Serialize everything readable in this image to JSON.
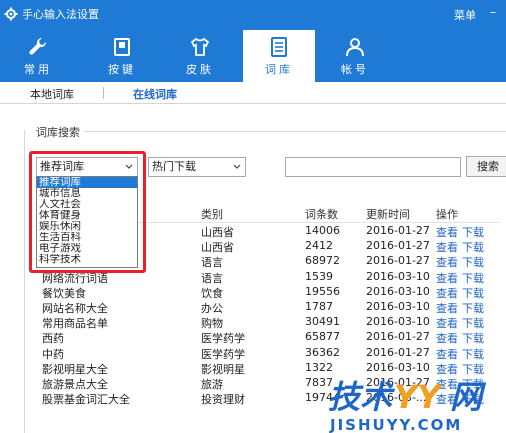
{
  "window": {
    "title": "手心输入法设置",
    "menu_label": "菜单",
    "min_glyph": "–"
  },
  "tabs": [
    {
      "label": "常用",
      "icon": "wrench-icon"
    },
    {
      "label": "按键",
      "icon": "keyboard-icon"
    },
    {
      "label": "皮肤",
      "icon": "shirt-icon"
    },
    {
      "label": "词库",
      "icon": "dictionary-icon",
      "active": true
    },
    {
      "label": "帐号",
      "icon": "user-icon"
    }
  ],
  "subtabs": {
    "local": "本地词库",
    "online": "在线词库"
  },
  "search_group": {
    "label": "词库搜索",
    "category_select": "推荐词库",
    "sort_select": "热门下载",
    "search_value": "",
    "search_button": "搜索"
  },
  "dropdown": {
    "items": [
      "推荐词库",
      "城市信息",
      "人文社会",
      "体育健身",
      "娱乐休闲",
      "生活百科",
      "电子游戏",
      "科学技术"
    ],
    "selected": 0
  },
  "table": {
    "headers": [
      "类别",
      "词条数",
      "更新时间",
      "操作"
    ],
    "rows": [
      {
        "name": "",
        "category": "山西省",
        "count": "14006",
        "updated": "2016-01-27",
        "view": "查看",
        "download": "下载"
      },
      {
        "name": "",
        "category": "山西省",
        "count": "2412",
        "updated": "2016-01-27",
        "view": "查看",
        "download": "下载"
      },
      {
        "name": "",
        "category": "语言",
        "count": "68972",
        "updated": "2016-01-27",
        "view": "查看",
        "download": "下载"
      },
      {
        "name": "网络流行词语",
        "category": "语言",
        "count": "1539",
        "updated": "2016-03-10",
        "view": "查看",
        "download": "下载"
      },
      {
        "name": "餐饮美食",
        "category": "饮食",
        "count": "19556",
        "updated": "2016-03-10",
        "view": "查看",
        "download": "下载"
      },
      {
        "name": "网站名称大全",
        "category": "办公",
        "count": "1787",
        "updated": "2016-03-10",
        "view": "查看",
        "download": "下载"
      },
      {
        "name": "常用商品名单",
        "category": "购物",
        "count": "30491",
        "updated": "2016-03-10",
        "view": "查看",
        "download": "下载"
      },
      {
        "name": "西药",
        "category": "医学药学",
        "count": "65877",
        "updated": "2016-01-27",
        "view": "查看",
        "download": "下载"
      },
      {
        "name": "中药",
        "category": "医学药学",
        "count": "36362",
        "updated": "2016-01-27",
        "view": "查看",
        "download": "下载"
      },
      {
        "name": "影视明星大全",
        "category": "影视明星",
        "count": "1322",
        "updated": "2016-03-10",
        "view": "查看",
        "download": "下载"
      },
      {
        "name": "旅游景点大全",
        "category": "旅游",
        "count": "7837",
        "updated": "2016-01-27",
        "view": "查看",
        "download": "下载"
      },
      {
        "name": "股票基金词汇大全",
        "category": "投资理财",
        "count": "19744",
        "updated": "2016-03-...",
        "view": "查看",
        "download": "下载"
      }
    ]
  },
  "watermark": {
    "brand": "技术YY网",
    "domain": "JISHUYY.COM"
  },
  "colors": {
    "accent": "#1f7ad6",
    "highlight_border": "#e8202a",
    "link": "#1f66c9"
  }
}
